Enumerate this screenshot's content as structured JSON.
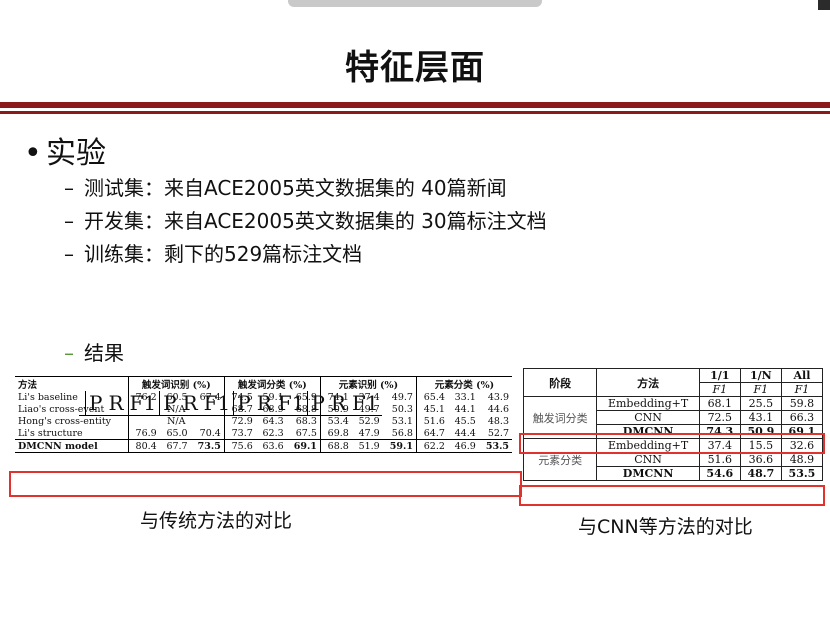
{
  "slide": {
    "title": "特征层面",
    "bullet": "实验",
    "items": [
      "测试集：来自ACE2005英文数据集的 40篇新闻",
      "开发集：来自ACE2005英文数据集的 30篇标注文档",
      "训练集：剩下的529篇标注文档"
    ],
    "result_label": "结果",
    "caption_left": "与传统方法的对比",
    "caption_right": "与CNN等方法的对比"
  },
  "table1": {
    "groups": [
      "方法",
      "触发词识别 (%)",
      "触发词分类 (%)",
      "元素识别 (%)",
      "元素分类 (%)"
    ],
    "sub": [
      "P",
      "R",
      "F1"
    ],
    "rows": [
      {
        "name": "Li's baseline",
        "v": [
          "76.2",
          "60.5",
          "67.4",
          "74.5",
          "59.1",
          "65.9",
          "74.1",
          "37.4",
          "49.7",
          "65.4",
          "33.1",
          "43.9"
        ]
      },
      {
        "name": "Liao's cross-event",
        "na": "N/A",
        "v": [
          "68.7",
          "68.9",
          "68.8",
          "50.9",
          "49.7",
          "50.3",
          "45.1",
          "44.1",
          "44.6"
        ]
      },
      {
        "name": "Hong's cross-entity",
        "na": "N/A",
        "v": [
          "72.9",
          "64.3",
          "68.3",
          "53.4",
          "52.9",
          "53.1",
          "51.6",
          "45.5",
          "48.3"
        ]
      },
      {
        "name": "Li's structure",
        "v": [
          "76.9",
          "65.0",
          "70.4",
          "73.7",
          "62.3",
          "67.5",
          "69.8",
          "47.9",
          "56.8",
          "64.7",
          "44.4",
          "52.7"
        ]
      },
      {
        "name": "DMCNN model",
        "v": [
          "80.4",
          "67.7",
          "73.5",
          "75.6",
          "63.6",
          "69.1",
          "68.8",
          "51.9",
          "59.1",
          "62.2",
          "46.9",
          "53.5"
        ]
      }
    ]
  },
  "table2": {
    "head": {
      "stage": "阶段",
      "method": "方法",
      "c1": "1/1",
      "c2": "1/N",
      "c3": "All",
      "f": "F1"
    },
    "stage1": "触发词分类",
    "stage2": "元素分类",
    "rows": [
      {
        "m": "Embedding+T",
        "v": [
          "68.1",
          "25.5",
          "59.8"
        ]
      },
      {
        "m": "CNN",
        "v": [
          "72.5",
          "43.1",
          "66.3"
        ]
      },
      {
        "m": "DMCNN",
        "v": [
          "74.3",
          "50.9",
          "69.1"
        ]
      },
      {
        "m": "Embedding+T",
        "v": [
          "37.4",
          "15.5",
          "32.6"
        ]
      },
      {
        "m": "CNN",
        "v": [
          "51.6",
          "36.6",
          "48.9"
        ]
      },
      {
        "m": "DMCNN",
        "v": [
          "54.6",
          "48.7",
          "53.5"
        ]
      }
    ]
  }
}
